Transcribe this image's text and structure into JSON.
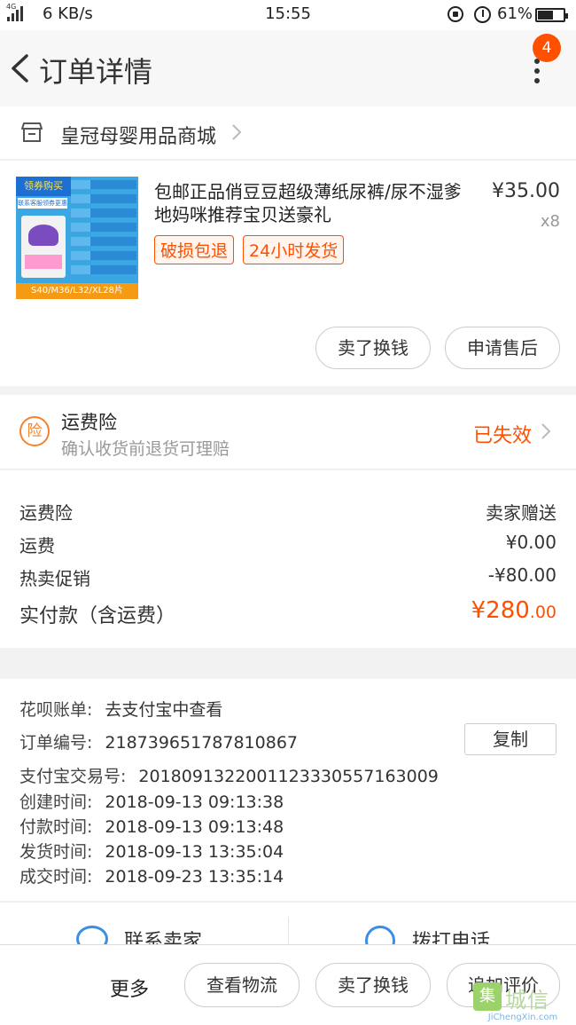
{
  "status_bar": {
    "network_label": "4G",
    "speed": "6 KB/s",
    "time": "15:55",
    "battery_percent": "61%",
    "battery_level": 0.61
  },
  "header": {
    "title": "订单详情",
    "notification_count": "4"
  },
  "shop": {
    "name": "皇冠母婴用品商城"
  },
  "product": {
    "title": "包邮正品俏豆豆超级薄纸尿裤/尿不湿爹地妈咪推荐宝贝送豪礼",
    "price": "¥35.00",
    "quantity": "x8",
    "tags": [
      "破损包退",
      "24小时发货"
    ],
    "image_text": {
      "banner": "领券购买",
      "sub": "联系客服领券更惠",
      "sizes": "S40/M36/L32/XL28片"
    },
    "buttons": {
      "sell": "卖了换钱",
      "after_sale": "申请售后"
    }
  },
  "insurance": {
    "icon_char": "险",
    "title": "运费险",
    "subtitle": "确认收货前退货可理赔",
    "status": "已失效"
  },
  "fees": {
    "rows": [
      {
        "label": "运费险",
        "value": "卖家赠送"
      },
      {
        "label": "运费",
        "value": "¥0.00"
      },
      {
        "label": "热卖促销",
        "value": "-¥80.00"
      }
    ],
    "total_label": "实付款（含运费）",
    "total_main": "¥280",
    "total_cents": ".00"
  },
  "order_info": {
    "huabei_label": "花呗账单:",
    "huabei_value": "去支付宝中查看",
    "order_no_label": "订单编号:",
    "order_no": "218739651787810867",
    "copy_label": "复制",
    "alipay_label": "支付宝交易号:",
    "alipay_no": "2018091322001123330557163009",
    "created_label": "创建时间:",
    "created": "2018-09-13 09:13:38",
    "paid_label": "付款时间:",
    "paid": "2018-09-13 09:13:48",
    "shipped_label": "发货时间:",
    "shipped": "2018-09-13 13:35:04",
    "closed_label": "成交时间:",
    "closed": "2018-09-23 13:35:14"
  },
  "contact": {
    "seller": "联系卖家",
    "call": "拨打电话"
  },
  "bottom_bar": {
    "more": "更多",
    "logistics": "查看物流",
    "sell": "卖了换钱",
    "review": "追加评价"
  },
  "watermark": {
    "logo": "集",
    "cn": "城信",
    "en": "JiChengXin.com"
  },
  "colors": {
    "accent": "#ff5000",
    "insurance_orange": "#f5832d",
    "link_blue": "#3a8ee6"
  }
}
